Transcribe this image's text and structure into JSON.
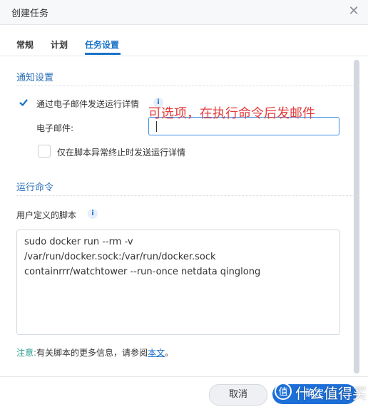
{
  "window": {
    "title": "创建任务"
  },
  "tabs": [
    {
      "label": "常规"
    },
    {
      "label": "计划"
    },
    {
      "label": "任务设置",
      "active": true
    }
  ],
  "notification": {
    "section_title": "通知设置",
    "send_email_label": "通过电子邮件发送运行详情",
    "send_email_checked": true,
    "email_label": "电子邮件:",
    "email_value": "",
    "annotation": "可选项，在执行命令后发邮件",
    "abnormal_only_label": "仅在脚本异常终止时发送运行详情",
    "abnormal_only_checked": false
  },
  "run_command": {
    "section_title": "运行命令",
    "script_label": "用户定义的脚本",
    "script_lines": [
      "sudo docker run --rm -v",
      "/var/run/docker.sock:/var/run/docker.sock",
      "containrrr/watchtower --run-once netdata qinglong"
    ]
  },
  "note": {
    "prefix": "注意:",
    "text": "有关脚本的更多信息，请参阅",
    "link": "本文",
    "suffix": "。"
  },
  "footer": {
    "cancel_label": "取消",
    "ok_label": "确定"
  },
  "watermark": {
    "text": "什么值得买"
  },
  "colors": {
    "accent": "#1a73c8",
    "primary_button": "#1d6fd8",
    "annotation": "#e43c3c"
  },
  "icons": {
    "close": "close-icon",
    "check": "check-icon",
    "info": "info-icon"
  }
}
